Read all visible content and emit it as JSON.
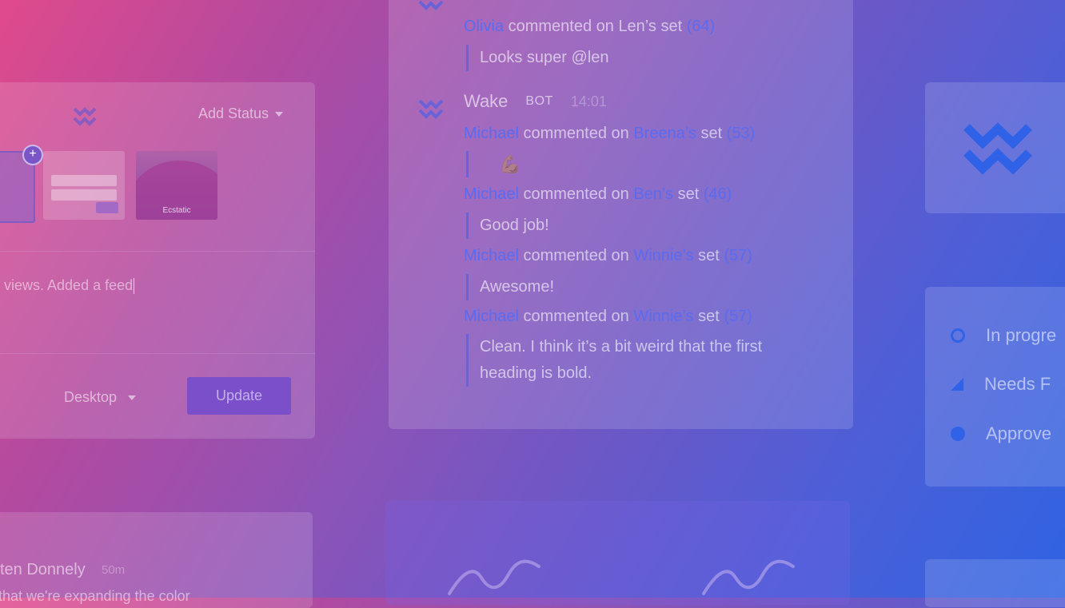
{
  "composer": {
    "add_status_label": "Add Status",
    "thumb_mood": "Ecstatic",
    "body_text": "p views. Added a feed",
    "device_label": "Desktop",
    "update_label": "Update"
  },
  "feed": {
    "top_comment": {
      "who": "Olivia",
      "verb": "commented on",
      "owner": "Len’s",
      "set": "set",
      "count": "(64)",
      "quote": "Looks super @len"
    },
    "bot": {
      "name": "Wake",
      "tag": "BOT",
      "time": "14:01"
    },
    "comments": [
      {
        "who": "Michael",
        "verb": "commented on",
        "owner": "Breena’s",
        "set": "set",
        "count": "(53)",
        "quote": "💪🏽"
      },
      {
        "who": "Michael",
        "verb": "commented on",
        "owner": "Ben’s",
        "set": "set",
        "count": "(46)",
        "quote": "Good job!"
      },
      {
        "who": "Michael",
        "verb": "commented on",
        "owner": "Winnie’s",
        "set": "set",
        "count": "(57)",
        "quote": "Awesome!"
      },
      {
        "who": "Michael",
        "verb": "commented on",
        "owner": "Winnie’s",
        "set": "set",
        "count": "(57)",
        "quote": "Clean. I think it’s a bit weird that the first heading is bold."
      }
    ]
  },
  "statuses": [
    {
      "label": "In progre",
      "icon": "ring-icon"
    },
    {
      "label": "Needs F",
      "icon": "triangle-icon"
    },
    {
      "label": "Approve",
      "icon": "dot-icon"
    }
  ],
  "activity": {
    "name": "ten Donnely",
    "ago": "50m",
    "message": "that we're expanding the color"
  },
  "colors": {
    "accent": "#5a6bf0",
    "button": "#7a4fc9",
    "status": "#2f62e6"
  }
}
